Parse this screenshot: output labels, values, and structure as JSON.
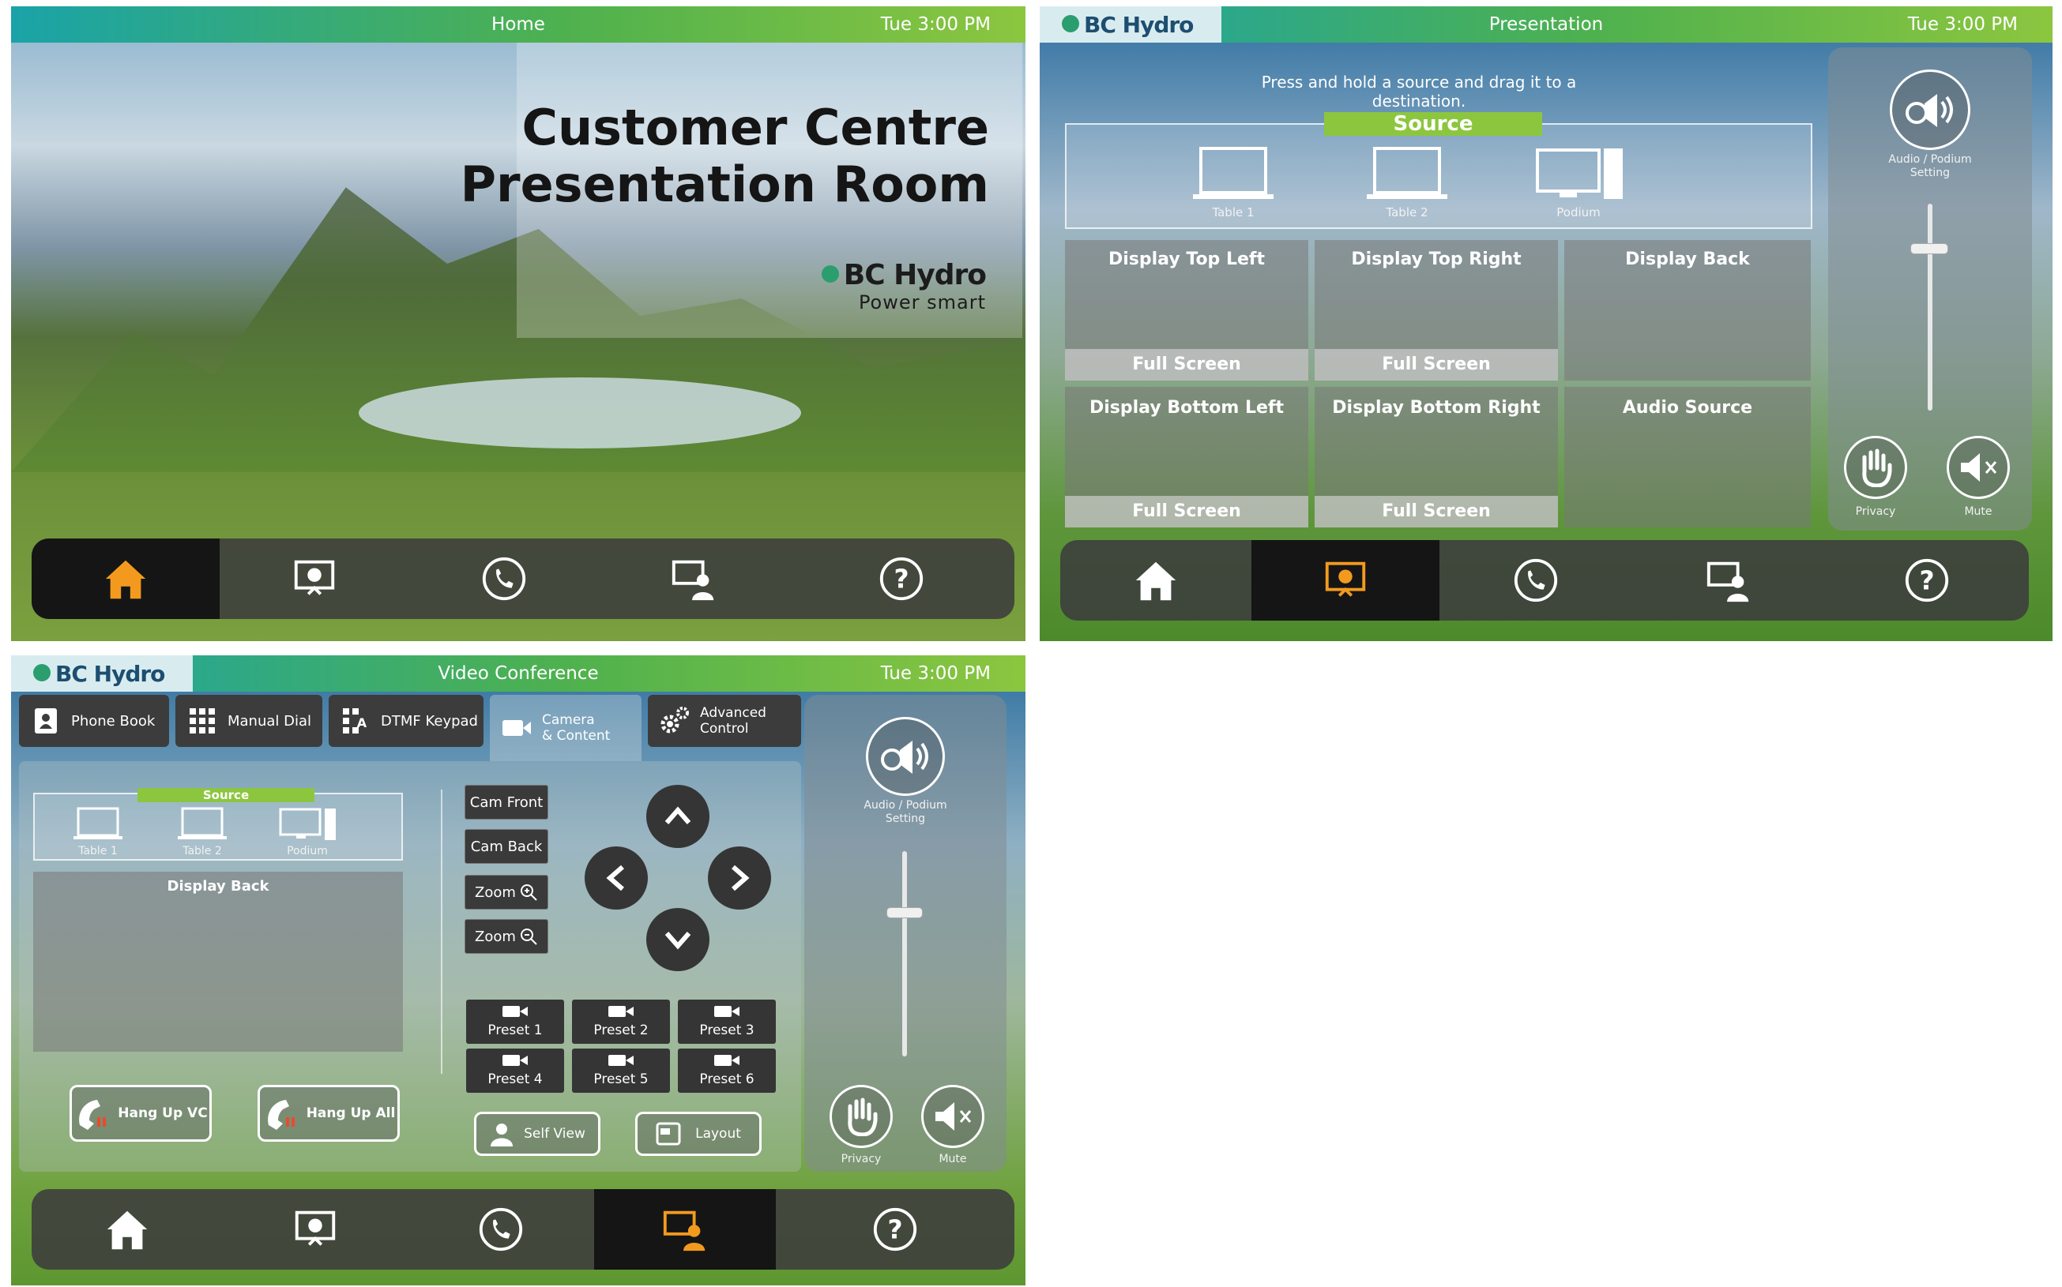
{
  "home": {
    "header_title": "Home",
    "time": "Tue 3:00 PM",
    "room_title_line1": "Customer Centre",
    "room_title_line2": "Presentation Room",
    "logo_name": "BC Hydro",
    "logo_tagline": "Power smart"
  },
  "presentation": {
    "logo": "BC Hydro",
    "header_title": "Presentation",
    "time": "Tue 3:00 PM",
    "instruction": "Press and hold a source and drag it to a destination.",
    "source_label": "Source",
    "sources": [
      "Table 1",
      "Table 2",
      "Podium"
    ],
    "displays": [
      {
        "label": "Display Top Left",
        "button": "Full Screen"
      },
      {
        "label": "Display Top Right",
        "button": "Full Screen"
      },
      {
        "label": "Display Back",
        "button": ""
      },
      {
        "label": "Display Bottom Left",
        "button": "Full Screen"
      },
      {
        "label": "Display Bottom Right",
        "button": "Full Screen"
      },
      {
        "label": "Audio Source",
        "button": ""
      }
    ],
    "audio_setting_line1": "Audio / Podium",
    "audio_setting_line2": "Setting",
    "volume_level": 0.78,
    "privacy_label": "Privacy",
    "mute_label": "Mute"
  },
  "video_conference": {
    "logo": "BC Hydro",
    "header_title": "Video Conference",
    "time": "Tue 3:00 PM",
    "tabs": [
      {
        "label": "Phone Book",
        "icon": "phone-book-icon"
      },
      {
        "label": "Manual Dial",
        "icon": "keypad-grid-icon"
      },
      {
        "label": "DTMF Keypad",
        "icon": "dtmf-keypad-icon"
      },
      {
        "label_line1": "Camera",
        "label_line2": "& Content",
        "icon": "camera-icon"
      },
      {
        "label_line1": "Advanced",
        "label_line2": "Control",
        "icon": "gears-icon"
      }
    ],
    "source_label": "Source",
    "sources": [
      "Table 1",
      "Table 2",
      "Podium"
    ],
    "display_label": "Display Back",
    "cam_front": "Cam Front",
    "cam_back": "Cam Back",
    "zoom_in": "Zoom",
    "zoom_out": "Zoom",
    "presets": [
      "Preset 1",
      "Preset 2",
      "Preset 3",
      "Preset 4",
      "Preset 5",
      "Preset 6"
    ],
    "hang_up_vc": "Hang Up VC",
    "hang_up_all": "Hang Up All",
    "self_view": "Self View",
    "layout": "Layout",
    "audio_setting_line1": "Audio / Podium",
    "audio_setting_line2": "Setting",
    "volume_level": 0.7,
    "privacy_label": "Privacy",
    "mute_label": "Mute"
  },
  "nav_icons": [
    "home-icon",
    "presentation-icon",
    "phone-icon",
    "video-conference-icon",
    "help-icon"
  ],
  "colors": {
    "accent_orange": "#f39a1e",
    "source_green": "#8cc63f",
    "header_teal": "#1aa3a8"
  }
}
